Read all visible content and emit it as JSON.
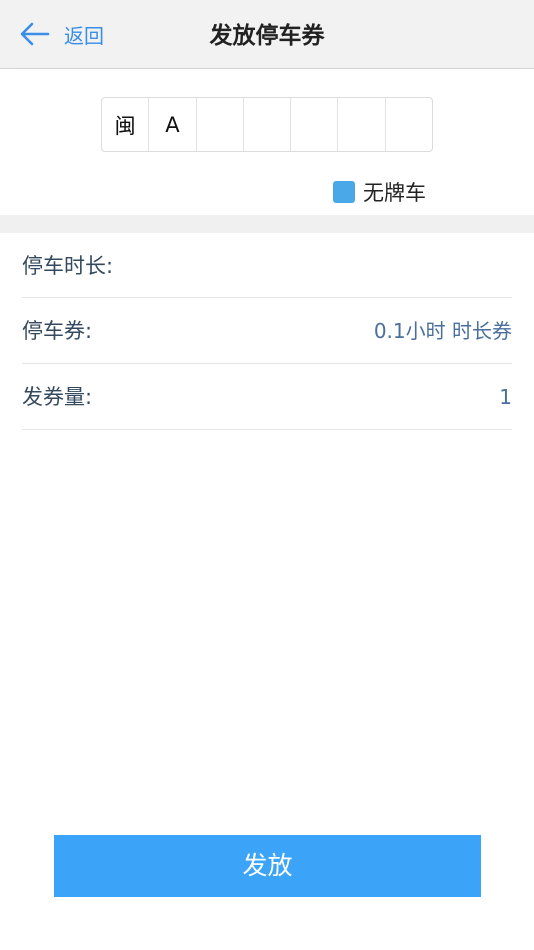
{
  "header": {
    "back_label": "返回",
    "title": "发放停车券"
  },
  "plate": {
    "cells": [
      "闽",
      "A",
      "",
      "",
      "",
      "",
      ""
    ],
    "no_plate_label": "无牌车",
    "checkbox_color": "#4aa7e8"
  },
  "form": {
    "rows": [
      {
        "label": "停车时长:",
        "value": ""
      },
      {
        "label": "停车券:",
        "value": "0.1小时 时长券"
      },
      {
        "label": "发券量:",
        "value": "1"
      }
    ]
  },
  "submit": {
    "label": "发放",
    "color": "#3ca4f8"
  },
  "icons": {
    "back": "arrow-left-icon"
  },
  "colors": {
    "accent": "#3a8ee6",
    "value_text": "#4a6f9c"
  }
}
